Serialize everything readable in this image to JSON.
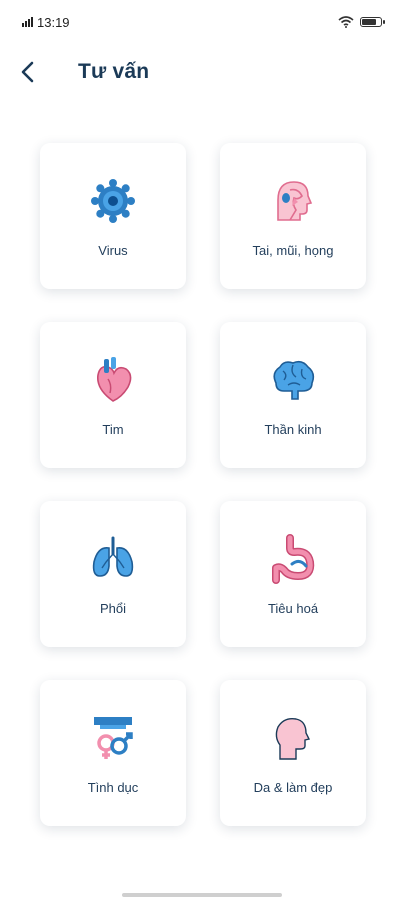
{
  "status": {
    "time": "13:19",
    "battery_level": 0.8
  },
  "header": {
    "title": "Tư vấn"
  },
  "icons": {
    "back": "chevron-left-icon"
  },
  "colors": {
    "title": "#1b3a57",
    "accent_blue": "#2d7fc4",
    "accent_pink": "#f28fae"
  },
  "categories": [
    {
      "label": "Virus",
      "icon": "virus-icon"
    },
    {
      "label": "Tai, mũi, họng",
      "icon": "ent-head-icon"
    },
    {
      "label": "Tim",
      "icon": "heart-icon"
    },
    {
      "label": "Thần kinh",
      "icon": "brain-icon"
    },
    {
      "label": "Phổi",
      "icon": "lungs-icon"
    },
    {
      "label": "Tiêu hoá",
      "icon": "stomach-icon"
    },
    {
      "label": "Tình dục",
      "icon": "gender-symbols-icon"
    },
    {
      "label": "Da & làm đẹp",
      "icon": "face-profile-icon"
    }
  ]
}
